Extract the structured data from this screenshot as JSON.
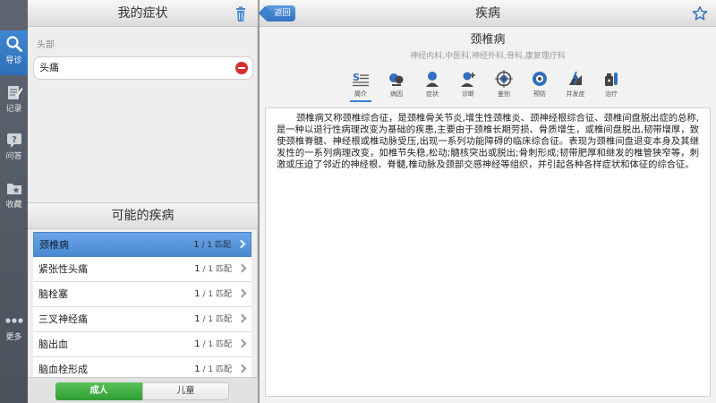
{
  "rail": {
    "items": [
      {
        "label": "导诊",
        "icon": "search-icon"
      },
      {
        "label": "记录",
        "icon": "notebook-icon"
      },
      {
        "label": "问答",
        "icon": "question-chat-icon"
      },
      {
        "label": "收藏",
        "icon": "star-folder-icon"
      },
      {
        "label": "更多",
        "icon": "more-dots-icon"
      }
    ]
  },
  "symptoms": {
    "title": "我的症状",
    "section": "头部",
    "items": [
      {
        "name": "头痛"
      }
    ]
  },
  "diseases": {
    "title": "可能的疾病",
    "items": [
      {
        "name": "颈椎病",
        "count": "1",
        "total": "/ 1 匹配",
        "selected": true
      },
      {
        "name": "紧张性头痛",
        "count": "1",
        "total": "/ 1 匹配",
        "selected": false
      },
      {
        "name": "脑栓塞",
        "count": "1",
        "total": "/ 1 匹配",
        "selected": false
      },
      {
        "name": "三叉神经痛",
        "count": "1",
        "total": "/ 1 匹配",
        "selected": false
      },
      {
        "name": "脑出血",
        "count": "1",
        "total": "/ 1 匹配",
        "selected": false
      },
      {
        "name": "脑血栓形成",
        "count": "1",
        "total": "/ 1 匹配",
        "selected": false
      }
    ]
  },
  "segment": {
    "adult": "成人",
    "child": "儿童",
    "active": "adult"
  },
  "detail": {
    "header_title": "疾病",
    "back_label": "返回",
    "disease_name": "颈椎病",
    "departments": "神经内科,中医科,神经外科,骨科,康复理疗科",
    "tabs": [
      {
        "label": "简介",
        "icon": "intro-icon",
        "active": true
      },
      {
        "label": "病因",
        "icon": "cause-icon",
        "active": false
      },
      {
        "label": "症状",
        "icon": "symptom-icon",
        "active": false
      },
      {
        "label": "诊断",
        "icon": "diagnosis-icon",
        "active": false
      },
      {
        "label": "鉴别",
        "icon": "differential-icon",
        "active": false
      },
      {
        "label": "预防",
        "icon": "prevention-icon",
        "active": false
      },
      {
        "label": "并发症",
        "icon": "complication-icon",
        "active": false
      },
      {
        "label": "治疗",
        "icon": "treatment-icon",
        "active": false
      }
    ],
    "content": "颈椎病又称颈椎综合征，是颈椎骨关节炎,增生性颈椎炎、颈神经根综合征、颈椎间盘脱出症的总称,是一种以退行性病理改变为基础的疾患,主要由于颈椎长期劳损、骨质增生，或椎间盘脱出,韧带增厚，致使颈椎脊髓、神经根或椎动脉受压,出现一系列功能障碍的临床综合征。表现为颈椎间盘退变本身及其继发性的一系列病理改变，如椎节失稳,松动;髓核突出或脱出;骨刺形成;韧带肥厚和继发的椎管狭窄等，刺激或压迫了邻近的神经根、脊髓,椎动脉及颈部交感神经等组织，并引起各种各样症状和体征的综合征。"
  },
  "colors": {
    "accent": "#3d7fd0",
    "rail": "#515a63",
    "adult_green": "#3aa83e",
    "remove_red": "#d62f2f"
  }
}
